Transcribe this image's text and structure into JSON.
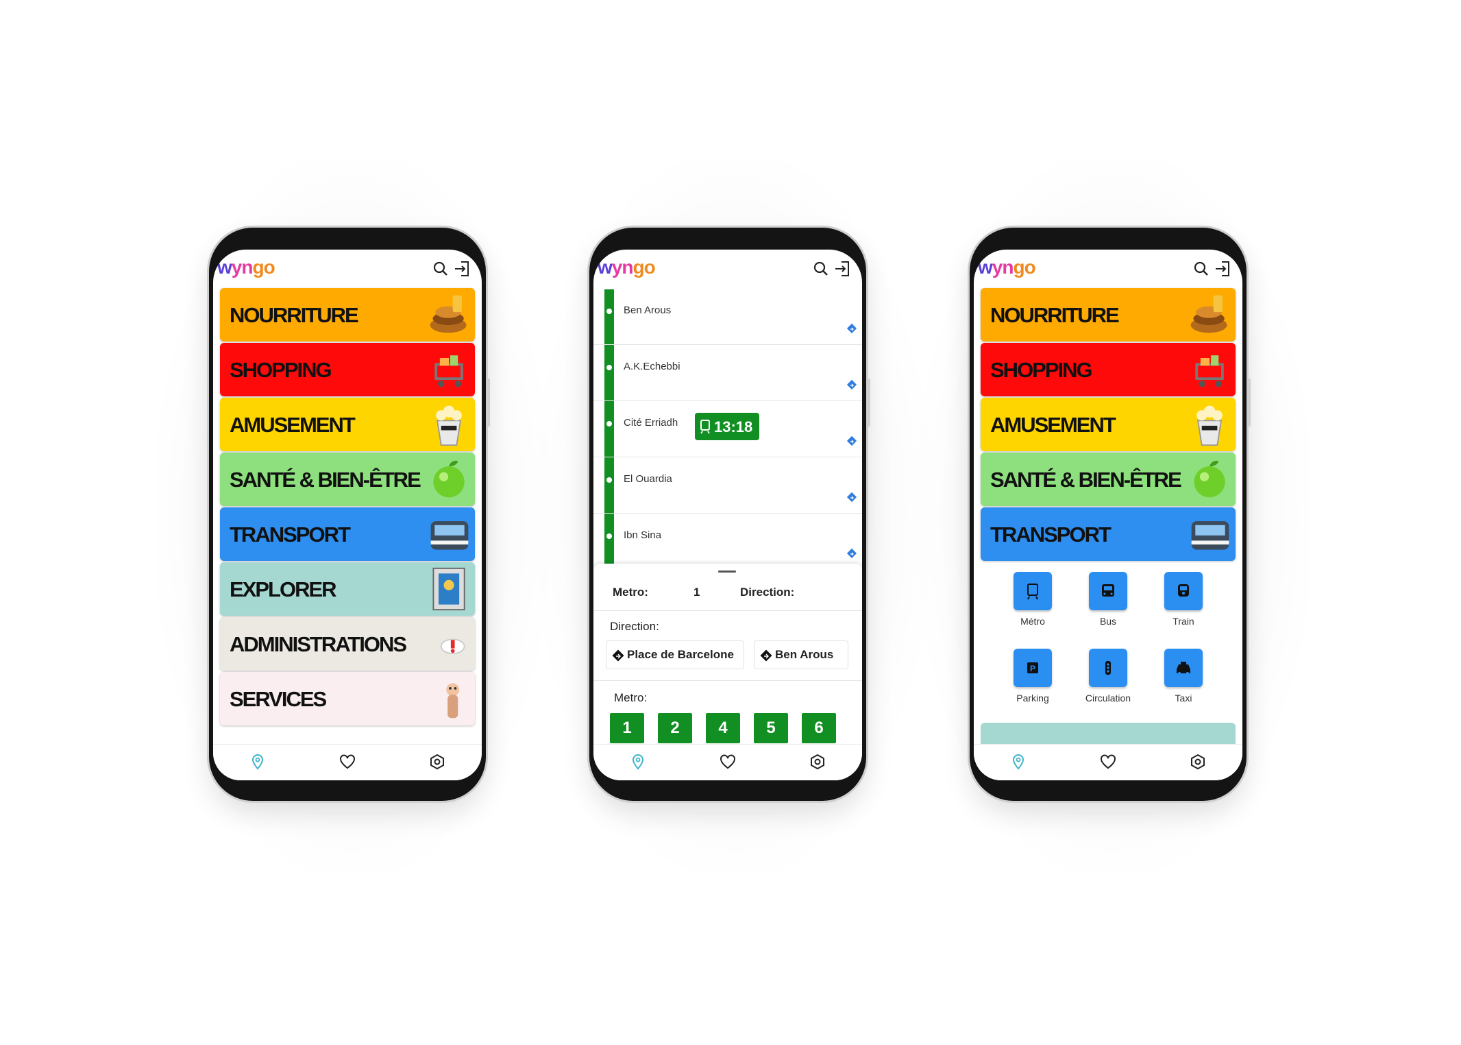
{
  "app": {
    "logo": {
      "part1": "w",
      "part2": "yn",
      "part3": "go"
    }
  },
  "categories": [
    {
      "label": "NOURRITURE",
      "color": "#ffaa00",
      "icon": "food-icon"
    },
    {
      "label": "SHOPPING",
      "color": "#ff0a0a",
      "icon": "cart-icon"
    },
    {
      "label": "AMUSEMENT",
      "color": "#ffd500",
      "icon": "popcorn-icon"
    },
    {
      "label": "SANTÉ & BIEN-ÊTRE",
      "color": "#8ee07e",
      "icon": "apple-icon"
    },
    {
      "label": "TRANSPORT",
      "color": "#2e8ff0",
      "icon": "train-icon"
    },
    {
      "label": "EXPLORER",
      "color": "#a6d8d2",
      "icon": "museum-icon"
    },
    {
      "label": "ADMINISTRATIONS",
      "color": "#ece9e3",
      "icon": "alert-icon"
    },
    {
      "label": "SERVICES",
      "color": "#fbeef0",
      "icon": "hand-icon"
    }
  ],
  "metro_screen": {
    "stops": [
      {
        "name": "Ben Arous"
      },
      {
        "name": "A.K.Echebbi"
      },
      {
        "name": "Cité Erriadh"
      },
      {
        "name": "El Ouardia"
      },
      {
        "name": "Ibn Sina"
      }
    ],
    "badge_time": "13:18",
    "sheet": {
      "metro_label": "Metro:",
      "metro_value": "1",
      "direction_label": "Direction:",
      "direction_title": "Direction:",
      "directions": [
        "Place de Barcelone",
        "Ben Arous"
      ],
      "metro_list_label": "Metro:",
      "lines": [
        "1",
        "2",
        "4",
        "5",
        "6"
      ]
    }
  },
  "transport_screen": {
    "modes": [
      {
        "label": "Métro",
        "icon": "metro-icon"
      },
      {
        "label": "Bus",
        "icon": "bus-icon"
      },
      {
        "label": "Train",
        "icon": "train-icon"
      },
      {
        "label": "Parking",
        "icon": "parking-icon"
      },
      {
        "label": "Circulation",
        "icon": "traffic-icon"
      },
      {
        "label": "Taxi",
        "icon": "taxi-icon"
      }
    ]
  },
  "colors": {
    "metro_green": "#128f22",
    "tile_blue": "#2b8ff2",
    "nav_active": "#3bb3c9"
  }
}
